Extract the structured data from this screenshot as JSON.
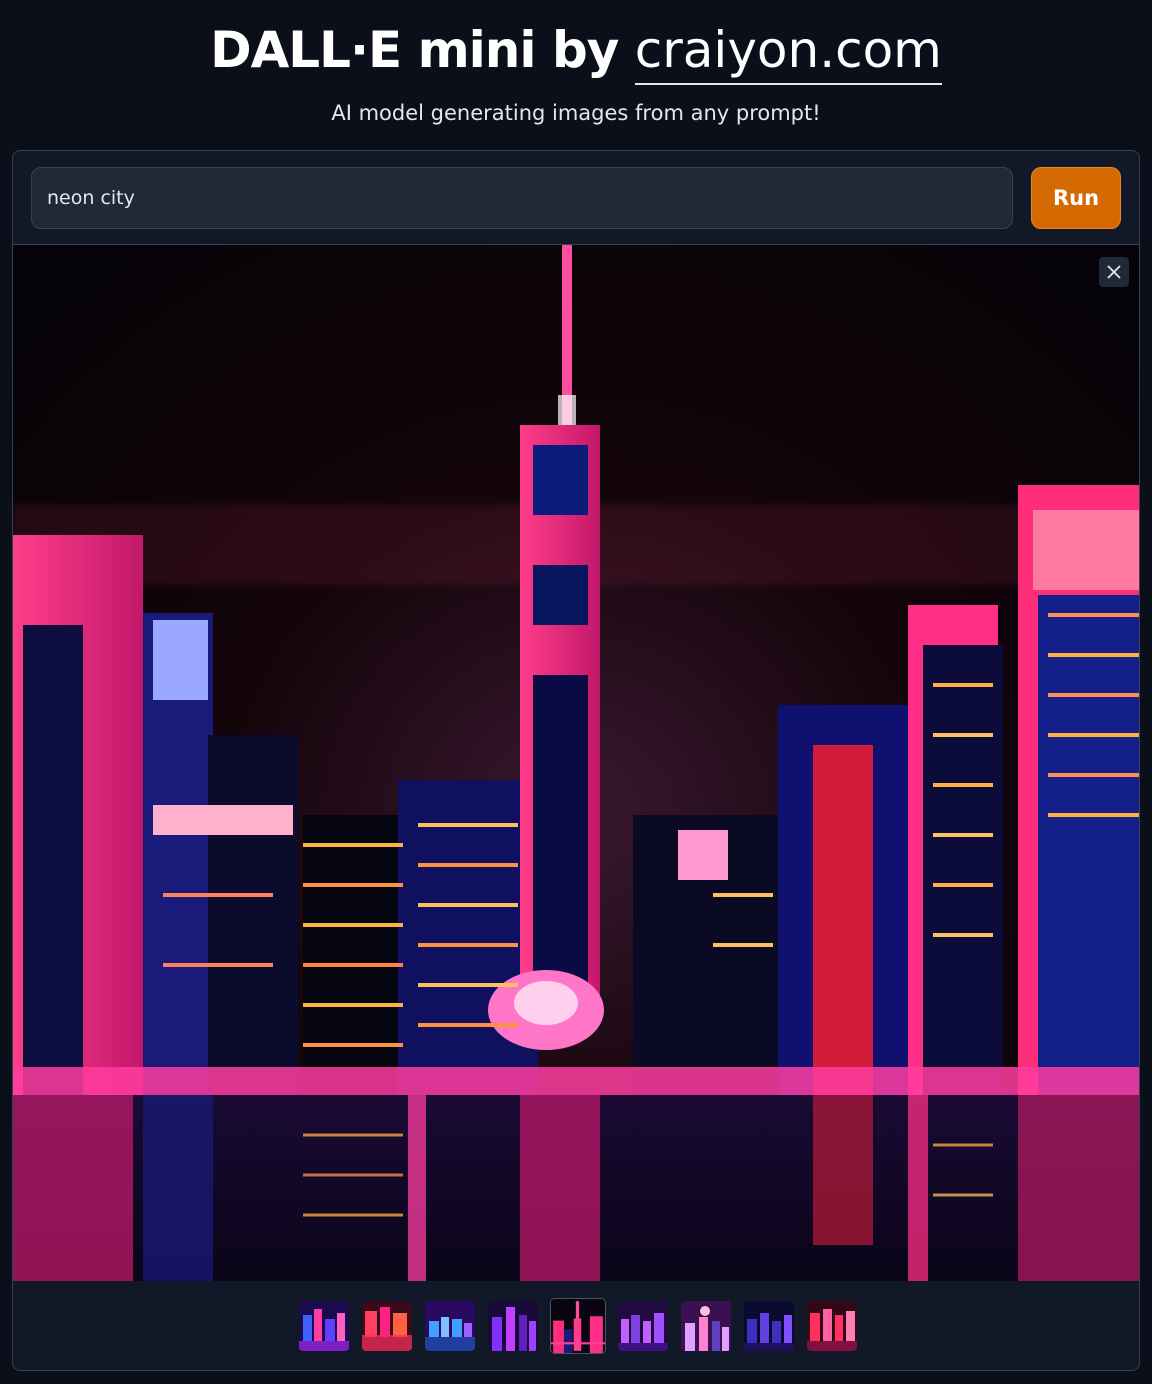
{
  "header": {
    "title_prefix": "DALL·E mini by ",
    "title_link": "craiyon.com",
    "subtitle": "AI model generating images from any prompt!"
  },
  "prompt": {
    "value": "neon city",
    "placeholder": ""
  },
  "run_button": {
    "label": "Run"
  },
  "gallery": {
    "selected_index": 4,
    "thumbnail_count": 9
  },
  "colors": {
    "background": "#0b0f19",
    "panel": "#111827",
    "input": "#1f2937",
    "accent": "#d66a02"
  }
}
